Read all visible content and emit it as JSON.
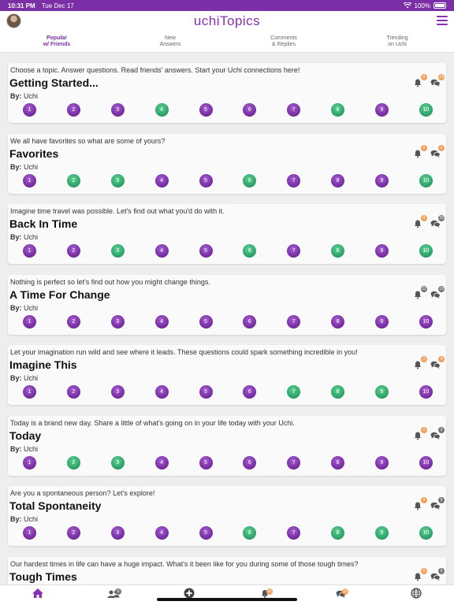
{
  "status_bar": {
    "time": "10:31 PM",
    "date": "Tue Dec 17",
    "battery": "100%"
  },
  "app": {
    "title": "uchiTopics",
    "accent": "#7b2fa6",
    "answered_color": "#2fa66a"
  },
  "tabs": [
    {
      "line1": "Popular",
      "line2": "w/ Friends",
      "active": true
    },
    {
      "line1": "New",
      "line2": "Answers",
      "active": false
    },
    {
      "line1": "Comments",
      "line2": "& Replies",
      "active": false
    },
    {
      "line1": "Trending",
      "line2": "on Uchi",
      "active": false
    }
  ],
  "by_label": "By:",
  "topics": [
    {
      "description": "Choose a topic. Answer questions. Read friends' answers. Start your Uchi connections here!",
      "title": "Getting Started...",
      "author": "Uchi",
      "notifications": "3",
      "notif_color": "orange",
      "comments": "13",
      "comment_color": "orange",
      "questions": [
        "1",
        "2",
        "3",
        "4",
        "5",
        "6",
        "7",
        "8",
        "9",
        "10"
      ],
      "answered": [
        false,
        false,
        false,
        true,
        false,
        false,
        false,
        true,
        false,
        true
      ]
    },
    {
      "description": "We all have favorites so what are some of yours?",
      "title": "Favorites",
      "author": "Uchi",
      "notifications": "5",
      "notif_color": "orange",
      "comments": "3",
      "comment_color": "orange",
      "questions": [
        "1",
        "2",
        "3",
        "4",
        "5",
        "6",
        "7",
        "8",
        "9",
        "10"
      ],
      "answered": [
        false,
        true,
        true,
        false,
        false,
        true,
        false,
        false,
        false,
        true
      ]
    },
    {
      "description": "Imagine time travel was possible. Let's find out what you'd do with it.",
      "title": "Back In Time",
      "author": "Uchi",
      "notifications": "4",
      "notif_color": "orange",
      "comments": "29",
      "comment_color": "gray",
      "questions": [
        "1",
        "2",
        "3",
        "4",
        "5",
        "6",
        "7",
        "8",
        "9",
        "10"
      ],
      "answered": [
        false,
        false,
        true,
        false,
        false,
        true,
        false,
        true,
        false,
        true
      ]
    },
    {
      "description": "Nothing is perfect so let's find out how you might change things.",
      "title": "A Time For Change",
      "author": "Uchi",
      "notifications": "22",
      "notif_color": "gray",
      "comments": "19",
      "comment_color": "gray",
      "questions": [
        "1",
        "2",
        "3",
        "4",
        "5",
        "6",
        "7",
        "8",
        "9",
        "10"
      ],
      "answered": [
        false,
        false,
        false,
        false,
        false,
        false,
        false,
        false,
        false,
        false
      ]
    },
    {
      "description": "Let your imagination run wild and see where it leads. These questions could spark something incredible in you!",
      "title": "Imagine This",
      "author": "Uchi",
      "notifications": "3",
      "notif_color": "orange",
      "comments": "4",
      "comment_color": "orange",
      "questions": [
        "1",
        "2",
        "3",
        "4",
        "5",
        "6",
        "7",
        "8",
        "9",
        "10"
      ],
      "answered": [
        false,
        false,
        false,
        false,
        false,
        false,
        true,
        true,
        true,
        false
      ]
    },
    {
      "description": "Today is a brand new day. Share a little of what's going on in your life today with your Uchi.",
      "title": "Today",
      "author": "Uchi",
      "notifications": "2",
      "notif_color": "orange",
      "comments": "3",
      "comment_color": "gray",
      "questions": [
        "1",
        "2",
        "3",
        "4",
        "5",
        "6",
        "7",
        "8",
        "9",
        "10"
      ],
      "answered": [
        false,
        true,
        true,
        false,
        false,
        false,
        false,
        false,
        false,
        false
      ]
    },
    {
      "description": "Are you a spontaneous person? Let's explore!",
      "title": "Total Spontaneity",
      "author": "Uchi",
      "notifications": "4",
      "notif_color": "orange",
      "comments": "5",
      "comment_color": "gray",
      "questions": [
        "1",
        "2",
        "3",
        "4",
        "5",
        "6",
        "7",
        "8",
        "9",
        "10"
      ],
      "answered": [
        false,
        false,
        false,
        false,
        false,
        true,
        false,
        true,
        true,
        true
      ]
    },
    {
      "description": "Our hardest times in life can have a huge impact. What's it been like for you during some of those tough times?",
      "title": "Tough Times",
      "author": "Uchi",
      "notifications": "6",
      "notif_color": "orange",
      "comments": "5",
      "comment_color": "gray",
      "questions": [],
      "answered": []
    }
  ],
  "bottom_nav": [
    {
      "icon": "home-icon",
      "badge": ""
    },
    {
      "icon": "friends-icon",
      "badge": "0",
      "badge_color": "gray"
    },
    {
      "icon": "add-icon",
      "badge": ""
    },
    {
      "icon": "bell-icon",
      "badge": "61",
      "badge_color": "orange"
    },
    {
      "icon": "chat-icon",
      "badge": "22",
      "badge_color": "orange"
    },
    {
      "icon": "globe-icon",
      "badge": ""
    }
  ]
}
